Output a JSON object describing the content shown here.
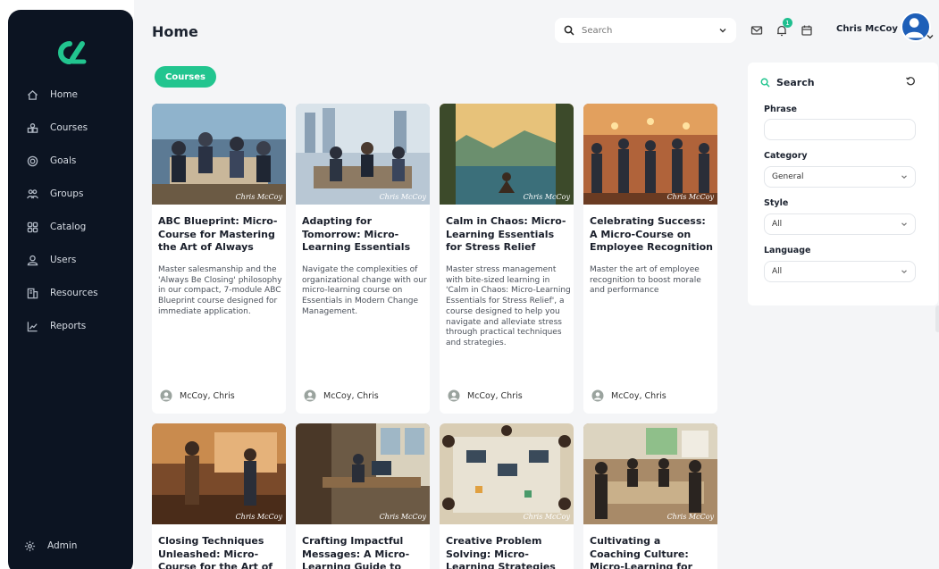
{
  "sidebar": {
    "items": [
      {
        "label": "Home",
        "icon": "home-icon"
      },
      {
        "label": "Courses",
        "icon": "courses-icon"
      },
      {
        "label": "Goals",
        "icon": "goals-icon"
      },
      {
        "label": "Groups",
        "icon": "groups-icon"
      },
      {
        "label": "Catalog",
        "icon": "catalog-icon"
      },
      {
        "label": "Users",
        "icon": "users-icon"
      },
      {
        "label": "Resources",
        "icon": "resources-icon"
      },
      {
        "label": "Reports",
        "icon": "reports-icon"
      }
    ],
    "admin": {
      "label": "Admin",
      "icon": "gear-icon"
    }
  },
  "header": {
    "title": "Home",
    "search_placeholder": "Search",
    "user_name": "Chris McCoy",
    "notification_count": "1"
  },
  "chip": {
    "label": "Courses"
  },
  "colors": {
    "accent": "#22c58f",
    "sidebar": "#0c1422",
    "avatar": "#1e5fb8"
  },
  "courses": [
    {
      "title": "ABC Blueprint: Micro-Course for Mastering the Art of Always Be...",
      "description": "Master salesmanship and the 'Always Be Closing' philosophy in our compact, 7-module ABC Blueprint course designed for immediate application.",
      "author": "McCoy, Chris",
      "signature": "Chris McCoy"
    },
    {
      "title": "Adapting for Tomorrow: Micro-Learning Essentials i...",
      "description": "Navigate the complexities of organizational change with our micro-learning course on Essentials in Modern Change Management.",
      "author": "McCoy, Chris",
      "signature": "Chris McCoy"
    },
    {
      "title": "Calm in Chaos: Micro-Learning Essentials for Stress Relief",
      "description": "Master stress management with bite-sized learning in 'Calm in Chaos: Micro-Learning Essentials for Stress Relief', a course designed to help you navigate and alleviate stress through practical techniques and strategies.",
      "author": "McCoy, Chris",
      "signature": "Chris McCoy"
    },
    {
      "title": "Celebrating Success: A Micro-Course on Employee Recognition",
      "description": "Master the art of employee recognition to boost morale and performance",
      "author": "McCoy, Chris",
      "signature": "Chris McCoy"
    },
    {
      "title": "Closing Techniques Unleashed: Micro-Course for the Art of",
      "description": "",
      "author": "",
      "signature": "Chris McCoy"
    },
    {
      "title": "Crafting Impactful Messages: A Micro-Learning Guide to",
      "description": "",
      "author": "",
      "signature": "Chris McCoy"
    },
    {
      "title": "Creative Problem Solving: Micro-Learning Strategies",
      "description": "",
      "author": "",
      "signature": "Chris McCoy"
    },
    {
      "title": "Cultivating a Coaching Culture: Micro-Learning for",
      "description": "",
      "author": "",
      "signature": "Chris McCoy"
    }
  ],
  "filter": {
    "title": "Search",
    "phrase_label": "Phrase",
    "phrase_value": "",
    "category_label": "Category",
    "category_value": "General",
    "style_label": "Style",
    "style_value": "All",
    "language_label": "Language",
    "language_value": "All"
  }
}
